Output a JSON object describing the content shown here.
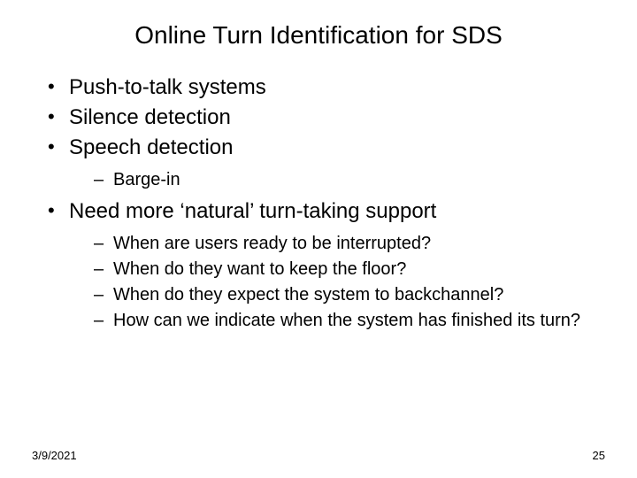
{
  "title": "Online Turn Identification for SDS",
  "bullets": {
    "b1": "Push-to-talk systems",
    "b2": "Silence detection",
    "b3": "Speech detection",
    "b3_sub1": "Barge-in",
    "b4": "Need more ‘natural’ turn-taking support",
    "b4_sub1": "When are users ready to be interrupted?",
    "b4_sub2": "When do they want to keep the floor?",
    "b4_sub3": "When do they expect the system to backchannel?",
    "b4_sub4": "How can we indicate when the system has finished its turn?"
  },
  "footer": {
    "date": "3/9/2021",
    "page": "25"
  }
}
